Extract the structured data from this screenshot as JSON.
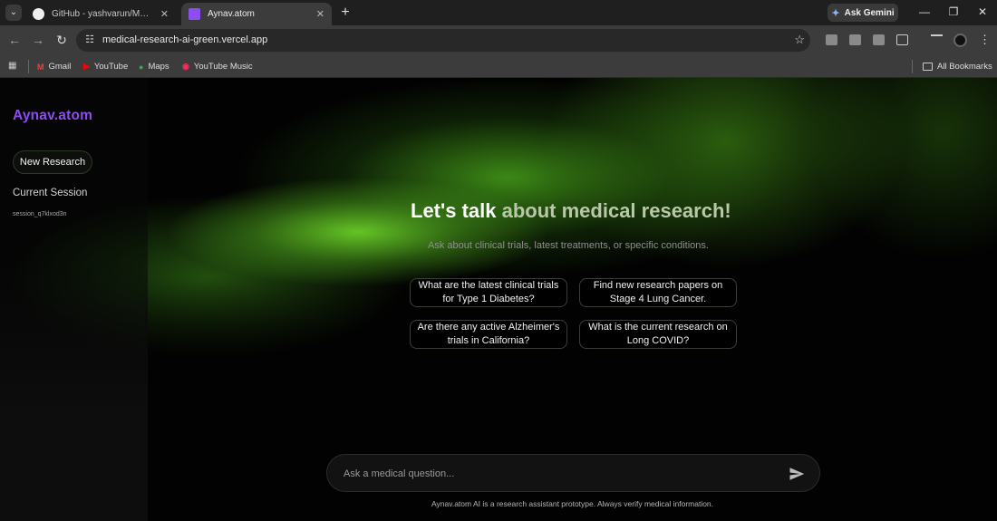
{
  "browser": {
    "tabs": [
      {
        "title": "GitHub - yashvarun/Medical-re",
        "active": false
      },
      {
        "title": "Aynav.atom",
        "active": true
      }
    ],
    "ask_gemini": "Ask Gemini",
    "url": "medical-research-ai-green.vercel.app",
    "bookmarks": [
      {
        "label": "Gmail",
        "icon": "gmail-icon"
      },
      {
        "label": "YouTube",
        "icon": "youtube-icon"
      },
      {
        "label": "Maps",
        "icon": "maps-icon"
      },
      {
        "label": "YouTube Music",
        "icon": "youtube-music-icon"
      }
    ],
    "all_bookmarks": "All Bookmarks"
  },
  "sidebar": {
    "brand": "Aynav.atom",
    "new_research": "New Research",
    "session_heading": "Current Session",
    "session_id": "session_q7klxod3n"
  },
  "main": {
    "hero_part1": "Let's talk",
    "hero_part2": "about medical research!",
    "subtitle": "Ask about clinical trials, latest treatments, or specific conditions.",
    "suggestions": [
      "What are the latest clinical trials for Type 1 Diabetes?",
      "Find new research papers on Stage 4 Lung Cancer.",
      "Are there any active Alzheimer's trials in California?",
      "What is the current research on Long COVID?"
    ],
    "input_placeholder": "Ask a medical question...",
    "disclaimer": "Aynav.atom AI is a research assistant prototype. Always verify medical information."
  },
  "colors": {
    "brand": "#8d4df0",
    "glow_green": "#69cd28"
  }
}
